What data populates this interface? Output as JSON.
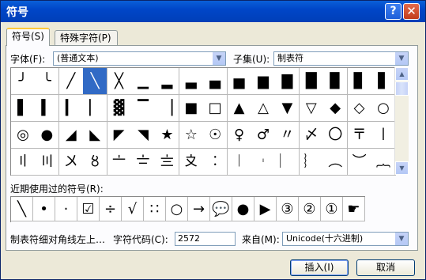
{
  "window": {
    "title": "符号",
    "help_label": "?",
    "close_label": "✕"
  },
  "tabs": [
    {
      "label": "符号(S)"
    },
    {
      "label": "特殊字符(P)"
    }
  ],
  "font": {
    "label": "字体(F):",
    "value": "(普通文本)"
  },
  "subset": {
    "label": "子集(U):",
    "value": "制表符"
  },
  "symbols": [
    [
      "╯",
      "╰",
      "╱",
      "╲",
      "╳",
      "▁",
      "▂",
      "▃",
      "▄",
      "▅",
      "▆",
      "▇",
      "█",
      "▉",
      "▊",
      "▋"
    ],
    [
      "▌",
      "▍",
      "▎",
      "▏",
      "▓",
      "▔",
      "▕",
      "■",
      "□",
      "▲",
      "△",
      "▼",
      "▽",
      "◆",
      "◇",
      "○"
    ],
    [
      "◎",
      "●",
      "◢",
      "◣",
      "◤",
      "◥",
      "★",
      "☆",
      "☉",
      "♀",
      "♂",
      "〃",
      "〆",
      "〇",
      "〒",
      "〡"
    ],
    [
      "〢",
      "〣",
      "〤",
      "〥",
      "〦",
      "〧",
      "〨",
      "〩",
      "︰",
      "︱",
      "︲",
      "︳",
      "︴",
      "︵",
      "︶",
      "︷"
    ]
  ],
  "recent": {
    "label": "近期使用过的符号(R):",
    "items": [
      "╲",
      "•",
      "·",
      "☑",
      "÷",
      "√",
      "∷",
      "○",
      "→",
      "💬",
      "●",
      "▶",
      "③",
      "②",
      "①",
      "☛"
    ]
  },
  "status": {
    "description": "制表符细对角线左上…",
    "code_label": "字符代码(C):",
    "code_value": "2572",
    "from_label": "来自(M):",
    "from_value": "Unicode(十六进制)"
  },
  "buttons": {
    "insert": "插入(I)",
    "cancel": "取消"
  }
}
